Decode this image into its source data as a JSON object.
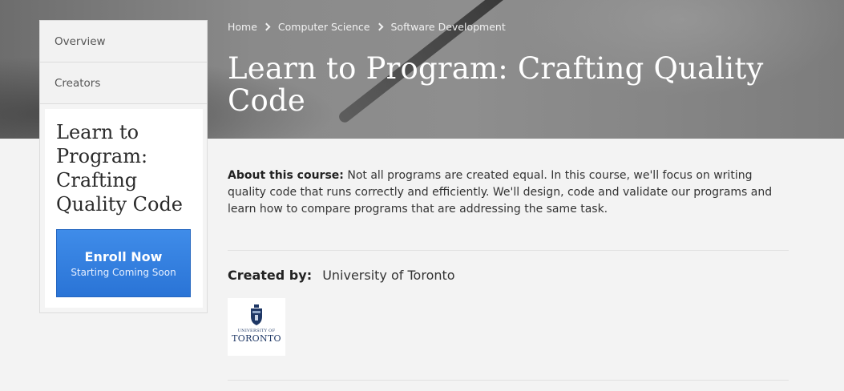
{
  "breadcrumb": {
    "items": [
      "Home",
      "Computer Science",
      "Software Development"
    ]
  },
  "course": {
    "title": "Learn to Program: Crafting Quality Code"
  },
  "sidebar": {
    "nav": [
      "Overview",
      "Creators"
    ],
    "card_title": "Learn to Program: Crafting Quality Code",
    "enroll_label": "Enroll Now",
    "enroll_sub": "Starting Coming Soon"
  },
  "about": {
    "label": "About this course:",
    "text": "Not all programs are created equal.  In this course, we'll focus on writing quality code that runs correctly and efficiently.  We'll design, code and validate our programs and learn how to compare programs that are addressing the same task."
  },
  "creators": {
    "label": "Created by:",
    "name": "University of Toronto",
    "logo_line1": "UNIVERSITY OF",
    "logo_line2": "TORONTO"
  },
  "colors": {
    "enroll_button": "#2f7ee0",
    "logo_navy": "#1e3765"
  },
  "icons": {
    "breadcrumb_separator": "chevron-right-icon",
    "logo_crest": "crest-icon"
  }
}
